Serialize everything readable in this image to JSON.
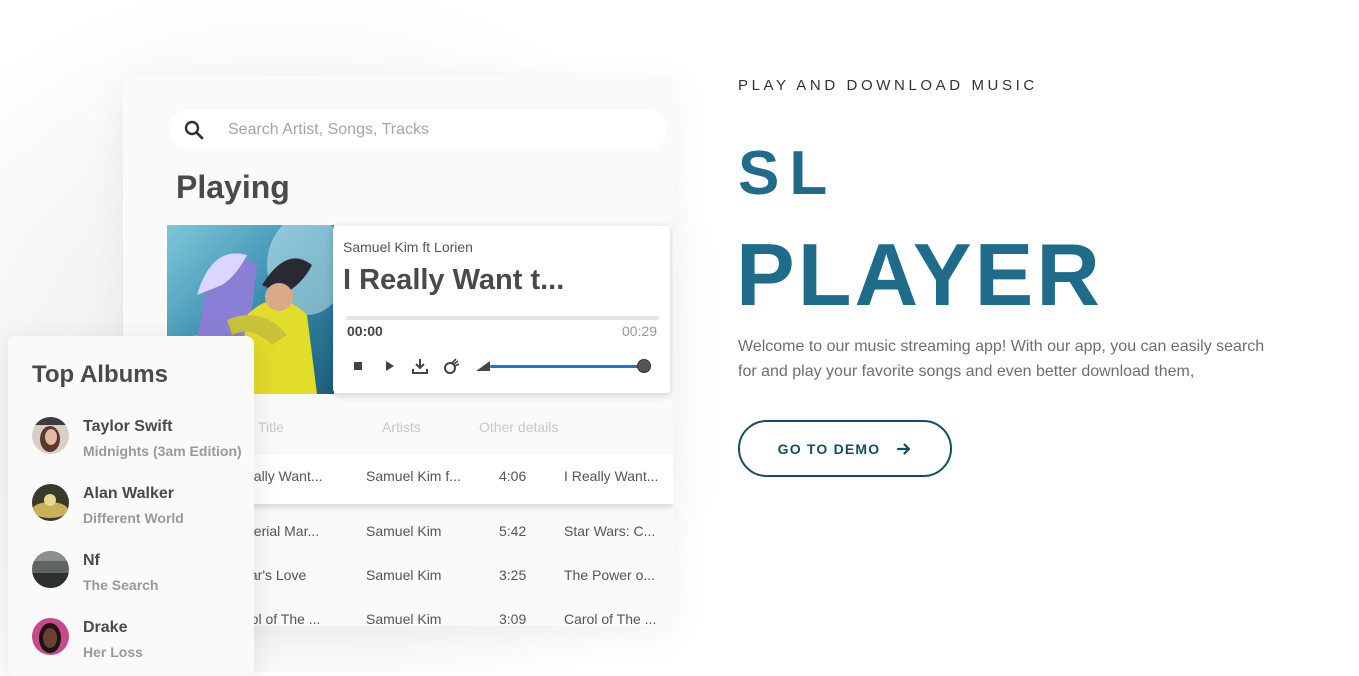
{
  "search": {
    "placeholder": "Search Artist, Songs, Tracks",
    "icon": "search-icon"
  },
  "player": {
    "section_title": "Playing",
    "artist": "Samuel Kim ft Lorien",
    "title": "I Really Want t...",
    "current_time": "00:00",
    "duration": "00:29",
    "progress_fraction": 0,
    "volume_fraction": 1.0,
    "accent_color": "#1976d2",
    "controls": [
      "stop-icon",
      "play-icon",
      "download-icon",
      "shuffle-icon",
      "volume-icon"
    ]
  },
  "tracks": {
    "headers": [
      "Title",
      "Artists",
      "Other details"
    ],
    "rows": [
      {
        "title": "eally Want...",
        "artist": "Samuel Kim f...",
        "time": "4:06",
        "album": "I Really Want..."
      },
      {
        "title": "perial Mar...",
        "artist": "Samuel Kim",
        "time": "5:42",
        "album": "Star Wars: C..."
      },
      {
        "title": "tar's Love",
        "artist": "Samuel Kim",
        "time": "3:25",
        "album": "The Power o..."
      },
      {
        "title": "rol of The ...",
        "artist": "Samuel Kim",
        "time": "3:09",
        "album": "Carol of The ..."
      }
    ]
  },
  "albums": {
    "title": "Top Albums",
    "items": [
      {
        "name": "Taylor Swift",
        "album": "Midnights (3am Edition)"
      },
      {
        "name": "Alan Walker",
        "album": "Different World"
      },
      {
        "name": "Nf",
        "album": "The Search"
      },
      {
        "name": "Drake",
        "album": "Her Loss"
      }
    ]
  },
  "hero": {
    "eyebrow": "PLAY AND DOWNLOAD MUSIC",
    "brand_line1": "SL",
    "brand_line2": "PLAYER",
    "description": "Welcome to our music streaming app! With our app, you can easily search for and play your favorite songs and even better download them,",
    "cta_label": "GO TO DEMO",
    "cta_icon": "arrow-right-icon",
    "brand_color": "#1f6c8a"
  }
}
